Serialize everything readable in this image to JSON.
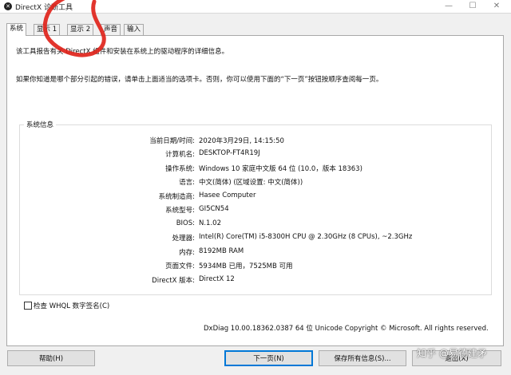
{
  "window": {
    "title": "DirectX 诊断工具",
    "minimize": "—",
    "maximize": "☐",
    "close": "✕"
  },
  "tabs": [
    {
      "label": "系统",
      "active": true
    },
    {
      "label": "显示 1",
      "active": false
    },
    {
      "label": "显示 2",
      "active": false
    },
    {
      "label": "声音",
      "active": false
    },
    {
      "label": "输入",
      "active": false
    }
  ],
  "intro": {
    "line1": "该工具报告有关 DirectX 组件和安装在系统上的驱动程序的详细信息。",
    "line2": "如果你知道是哪个部分引起的错误，请单击上面适当的选项卡。否则，你可以使用下面的“下一页”按钮按顺序查阅每一页。"
  },
  "system_info": {
    "group_title": "系统信息",
    "rows": [
      {
        "label": "当前日期/时间:",
        "value": "2020年3月29日, 14:15:50"
      },
      {
        "label": "计算机名:",
        "value": "DESKTOP-FT4R19J"
      },
      {
        "label": "操作系统:",
        "value": "Windows 10 家庭中文版 64 位 (10.0，版本 18363)"
      },
      {
        "label": "语言:",
        "value": "中文(简体) (区域设置: 中文(简体))"
      },
      {
        "label": "系统制造商:",
        "value": "Hasee Computer"
      },
      {
        "label": "系统型号:",
        "value": "GI5CN54"
      },
      {
        "label": "BIOS:",
        "value": "N.1.02"
      },
      {
        "label": "处理器:",
        "value": "Intel(R) Core(TM) i5-8300H CPU @ 2.30GHz (8 CPUs), ~2.3GHz"
      },
      {
        "label": "内存:",
        "value": "8192MB RAM"
      },
      {
        "label": "页面文件:",
        "value": "5934MB 已用，7525MB 可用"
      },
      {
        "label": "DirectX 版本:",
        "value": "DirectX 12"
      }
    ]
  },
  "whql_checkbox": {
    "label": "检查 WHQL 数字签名(C)",
    "checked": false
  },
  "footer_text": "DxDiag 10.00.18362.0387 64 位 Unicode  Copyright © Microsoft. All rights reserved.",
  "buttons": {
    "help": "帮助(H)",
    "next": "下一页(N)",
    "save_all": "保存所有信息(S)...",
    "exit": "退出(X)"
  },
  "watermark": "知乎 @易德建矛",
  "colors": {
    "accent": "#0078d7",
    "annotation": "#e0241b"
  }
}
